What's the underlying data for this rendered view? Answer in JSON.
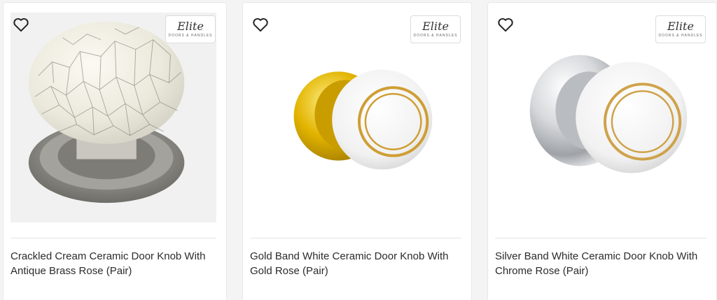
{
  "brand": {
    "logo_text": "Elite",
    "logo_subtext": "DOORS & HANDLES"
  },
  "products": [
    {
      "title": "Crackled Cream Ceramic Door Knob With Antique Brass Rose (Pair)"
    },
    {
      "title": "Gold Band White Ceramic Door Knob With Gold Rose (Pair)"
    },
    {
      "title": "Silver Band White Ceramic Door Knob With Chrome Rose (Pair)"
    }
  ],
  "icons": {
    "favorite": "heart-outline-icon"
  },
  "colors": {
    "text": "#2b2b2b",
    "border": "#e8e8e8",
    "gold": "#e2b400",
    "chrome": "#c9ccd0"
  }
}
